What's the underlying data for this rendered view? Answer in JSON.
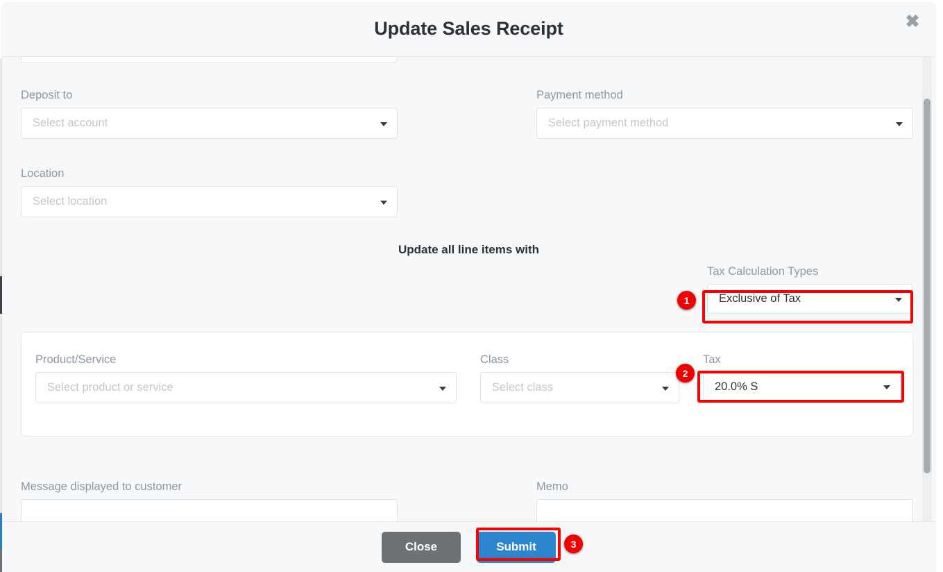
{
  "modal": {
    "title": "Update Sales Receipt",
    "close_icon": "close-icon",
    "close_glyph": "✖"
  },
  "form": {
    "deposit_to": {
      "label": "Deposit to",
      "placeholder": "Select account",
      "value": ""
    },
    "payment_method": {
      "label": "Payment method",
      "placeholder": "Select payment method",
      "value": ""
    },
    "location": {
      "label": "Location",
      "placeholder": "Select location",
      "value": ""
    }
  },
  "bulk_section": {
    "title": "Update all line items with",
    "tax_calculation_types": {
      "label": "Tax Calculation Types",
      "value": "Exclusive of Tax",
      "options": [
        "Exclusive of Tax"
      ]
    }
  },
  "line_item": {
    "product_service": {
      "label": "Product/Service",
      "placeholder": "Select product or service",
      "value": ""
    },
    "class": {
      "label": "Class",
      "placeholder": "Select class",
      "value": ""
    },
    "tax": {
      "label": "Tax",
      "value": "20.0% S",
      "options": [
        "20.0% S"
      ]
    }
  },
  "bottom": {
    "message_to_customer": {
      "label": "Message displayed to customer",
      "value": ""
    },
    "memo": {
      "label": "Memo",
      "value": ""
    }
  },
  "footer": {
    "close_label": "Close",
    "submit_label": "Submit"
  },
  "annotations": {
    "badge_1": "1",
    "badge_2": "2",
    "badge_3": "3",
    "highlight_color": "#fc0000",
    "badge_color": "#f20000"
  },
  "colors": {
    "modal_background": "#f7f8fa",
    "submit_blue": "#2b86cd",
    "close_gray": "#6f7275",
    "label_gray": "#8d96a3",
    "placeholder_gray": "#c2c7cd"
  }
}
